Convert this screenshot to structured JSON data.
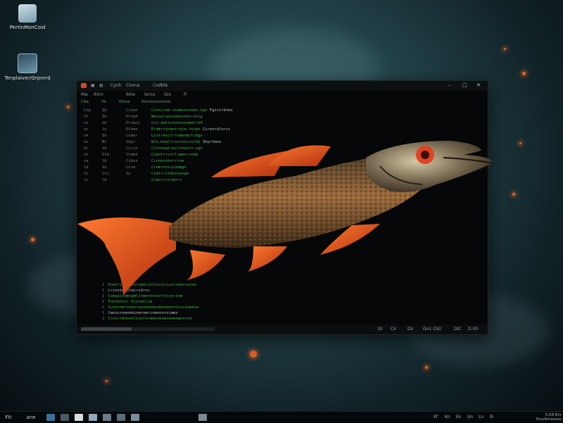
{
  "desktop": {
    "icons": [
      {
        "label": "PertinMonCoid",
        "color": "#9db7c2"
      },
      {
        "label": "Tenplaiver/Grpnrrd",
        "color": "#5f8aa0"
      }
    ]
  },
  "window": {
    "title_tabs": [
      "Cynh",
      "Cinrna",
      "Codbfe"
    ],
    "menu": [
      "Mw",
      "Itimr",
      "Ibhe",
      "Isnce",
      "Ilzs",
      "Fi"
    ],
    "toolstrip": [
      "Cibe",
      "Pir",
      "Pinma",
      "Rincioni/ontrocls"
    ],
    "code_rows": [
      {
        "ln": "Cip",
        "c2": "Ib",
        "c3": "Cinen",
        "code": "Cinn/cem-stmmsnoimen.ngo",
        "tail": "Fgcitrbtms"
      },
      {
        "ln": "ft",
        "c2": "Ib",
        "c3": "Pttmd",
        "code": "Wmloorvpcoomsonetronig",
        "tail": ""
      },
      {
        "ln": "nv",
        "c2": "ib",
        "c3": "Ptimoi",
        "code": "Cin-emtrrecmnsonmdrrb4",
        "tail": ""
      },
      {
        "ln": "oc",
        "c2": "lu",
        "c3": "Etbmo",
        "code": "Erdmrtonmnrreim-reimn",
        "tail": "Cireordlorsi"
      },
      {
        "ln": "ck",
        "c2": "Ib",
        "c3": "Cnmer",
        "code": "Cintresclrromenmctcmgo",
        "tail": ""
      },
      {
        "ln": "nc",
        "c2": "Bt",
        "c3": "Ibpr",
        "code": "Wrb.msmllroorensrnrbb",
        "tail": "Ibyrtmoo"
      },
      {
        "ln": "el",
        "c2": "ib",
        "c3": "Cyrin",
        "code": "Cintmngtrpilnoanrn.ngo",
        "tail": ""
      },
      {
        "ln": "ot",
        "c2": "Itb",
        "c3": "Ctmbd",
        "code": "Cimntrrosrlimmnrrnem",
        "tail": ""
      },
      {
        "ln": "ca",
        "c2": "lb",
        "c3": "Cibns",
        "code": "Cinnonsbnrrcnm",
        "tail": ""
      },
      {
        "ln": "ld",
        "c2": "Ib",
        "c3": "Cnim",
        "code": "Cinmrnnsiinmmgn",
        "tail": ""
      },
      {
        "ln": "fc",
        "c2": "lti",
        "c3": "Ip",
        "code": "Cimlrrstmnooongm",
        "tail": ""
      },
      {
        "ln": "lc",
        "c2": "lb",
        "c3": "",
        "code": "Cimnrrsrimnrn",
        "tail": ""
      }
    ],
    "terminal": [
      {
        "mark": "1",
        "text": "Poenlitcmlmnrsmalintcocoriunrinmrosnne",
        "dim": false
      },
      {
        "mark": "1",
        "text": "Lrinnimnolmcrsdrss",
        "dim": true
      },
      {
        "mark": "1",
        "text": "Cimaoscmmtgmlitmmntnimrrnlnnrinm",
        "dim": false
      },
      {
        "mark": "1",
        "text": "Fnntmlhnr Ecosmtlim",
        "dim": false
      },
      {
        "mark": "1",
        "text": "Ccnnrnmlncmnrannomndonmonemrnolnconmnon",
        "dim": false
      },
      {
        "mark": "1",
        "text": "Cmnosrnmnnminmrnmrinmnonrnimmn",
        "dim": true
      },
      {
        "mark": "1",
        "text": "Clnsrrmnonnlinnrnrmmnrmnmrmnmnmnnrnm",
        "dim": false
      }
    ],
    "status": {
      "progress": 0.38,
      "items": [
        "Dr",
        "Cir",
        "Dir",
        "Oo1 Cb0",
        "DiC",
        "D.00"
      ]
    }
  },
  "taskbar": {
    "start_label": "Fti",
    "search_label": "ane",
    "apps": [
      {
        "name": "explorer",
        "color": "#3a6f9a"
      },
      {
        "name": "terminal",
        "color": "#4b5a60"
      },
      {
        "name": "notes",
        "color": "#d8dcdf"
      },
      {
        "name": "photos",
        "color": "#8ea9b8"
      },
      {
        "name": "media",
        "color": "#6b7d86"
      },
      {
        "name": "settings",
        "color": "#5b6c74"
      },
      {
        "name": "store",
        "color": "#7a8c94"
      }
    ],
    "tray": [
      "Ef",
      "Kn",
      "En",
      "Un",
      "Ln",
      "Ei"
    ],
    "clock": {
      "time": "5:58 Ehr",
      "date": "Exs/Amsesos"
    }
  },
  "accents": {
    "fish_body": "#8a5a34",
    "fins": "#e0531f",
    "code_green": "#3fae3f"
  }
}
